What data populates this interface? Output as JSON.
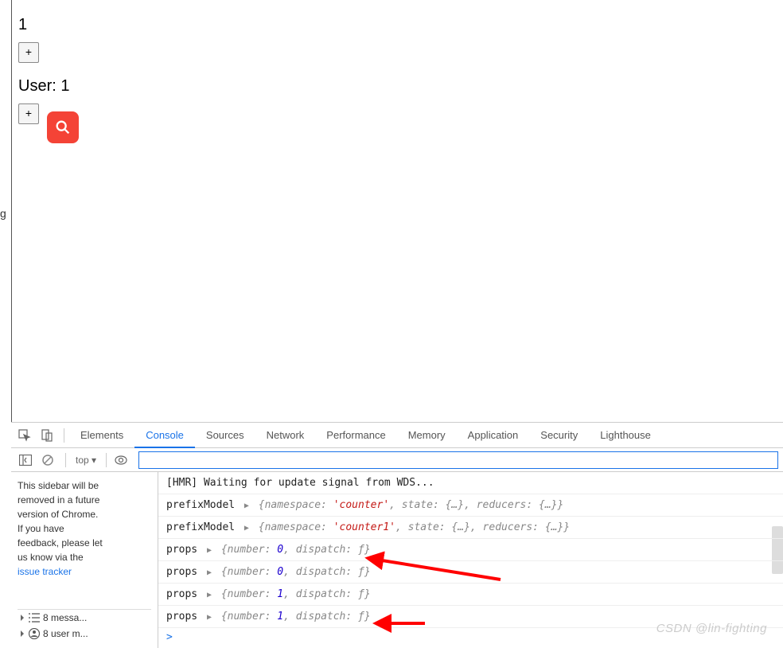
{
  "page": {
    "counter1": "1",
    "plus": "+",
    "user_label": "User: 1",
    "plus2": "+"
  },
  "devtools": {
    "tabs": [
      "Elements",
      "Console",
      "Sources",
      "Network",
      "Performance",
      "Memory",
      "Application",
      "Security",
      "Lighthouse"
    ],
    "active_tab": "Console",
    "toolbar": {
      "context": "top ▾",
      "filter_placeholder": ""
    },
    "sidebar": {
      "notice_lines": [
        "This sidebar will be",
        "removed in a future",
        "version of Chrome.",
        "If you have",
        "feedback, please let",
        "us know via the"
      ],
      "notice_link": "issue tracker",
      "rows": [
        {
          "icon": "list",
          "text": "8 messa..."
        },
        {
          "icon": "user",
          "text": "8 user m..."
        }
      ]
    },
    "console": {
      "lines": [
        {
          "kind": "plain",
          "text": "[HMR] Waiting for update signal from WDS..."
        },
        {
          "kind": "model",
          "label": "prefixModel",
          "ns": "'counter'"
        },
        {
          "kind": "model",
          "label": "prefixModel",
          "ns": "'counter1'"
        },
        {
          "kind": "props",
          "label": "props",
          "num": "0"
        },
        {
          "kind": "props",
          "label": "props",
          "num": "0"
        },
        {
          "kind": "props",
          "label": "props",
          "num": "1"
        },
        {
          "kind": "props",
          "label": "props",
          "num": "1"
        }
      ],
      "obj_prefix_model": ", state: {…}, reducers: {…}}",
      "obj_prefix_ns_key": "{namespace: ",
      "obj_props_open": "{number: ",
      "obj_props_close": ", dispatch: ƒ}",
      "prompt": ">"
    }
  },
  "watermark": "CSDN @lin-fighting",
  "left_tick": "g"
}
